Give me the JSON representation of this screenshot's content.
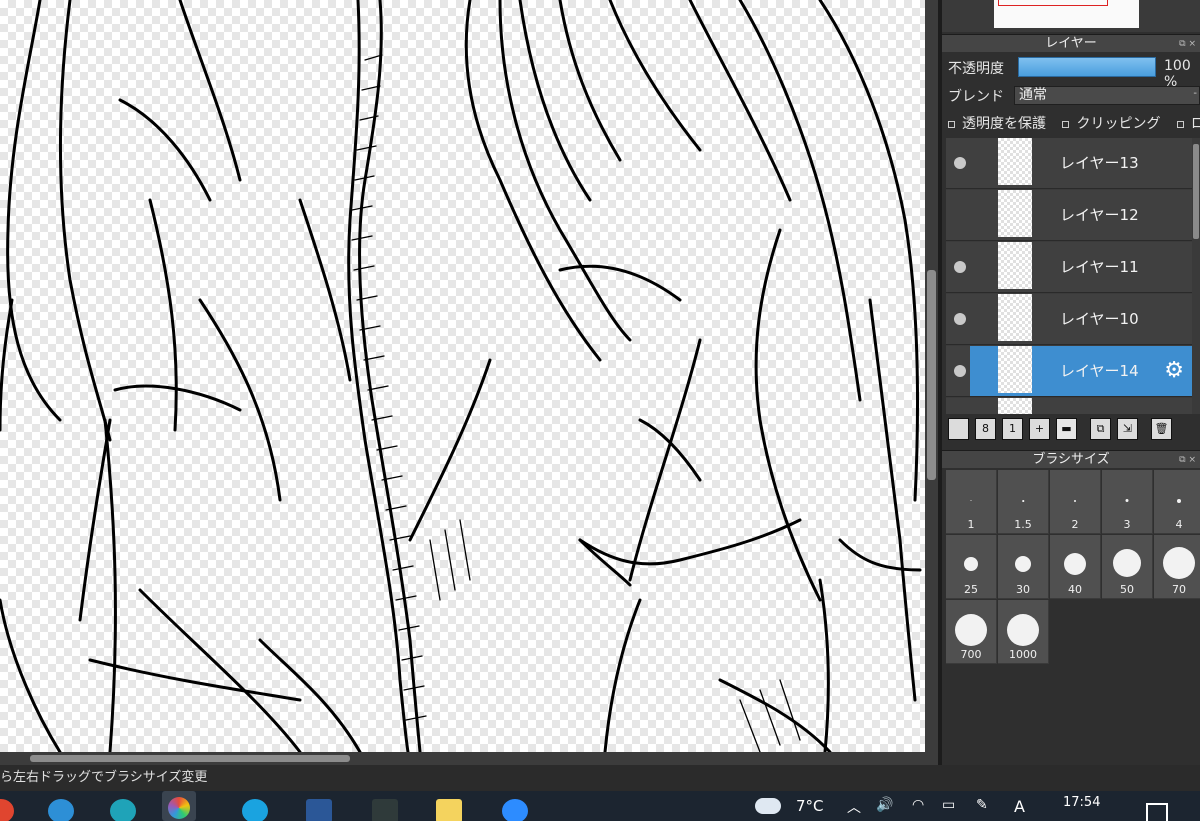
{
  "layer_panel": {
    "title": "レイヤー",
    "opacity_label": "不透明度",
    "opacity_value": "100 %",
    "opacity_percent": 100,
    "blend_label": "ブレンド",
    "blend_value": "通常",
    "options": [
      {
        "label": "透明度を保護"
      },
      {
        "label": "クリッピング"
      },
      {
        "label": "ロック"
      }
    ],
    "layers": [
      {
        "name": "レイヤー13",
        "visible": true,
        "selected": false
      },
      {
        "name": "レイヤー12",
        "visible": false,
        "selected": false
      },
      {
        "name": "レイヤー11",
        "visible": true,
        "selected": false
      },
      {
        "name": "レイヤー10",
        "visible": true,
        "selected": false
      },
      {
        "name": "レイヤー14",
        "visible": true,
        "selected": true
      }
    ],
    "toolbar": [
      {
        "name": "new-layer-button",
        "icon": "page-icon",
        "glyph": ""
      },
      {
        "name": "new-8bit-layer-button",
        "icon": "page-8-icon",
        "glyph": "8"
      },
      {
        "name": "new-1bit-layer-button",
        "icon": "page-1-icon",
        "glyph": "1"
      },
      {
        "name": "add-layer-menu-button",
        "icon": "page-plus-icon",
        "glyph": "+"
      },
      {
        "name": "new-folder-button",
        "icon": "folder-icon",
        "glyph": ""
      },
      {
        "name": "duplicate-layer-button",
        "icon": "duplicate-icon",
        "glyph": ""
      },
      {
        "name": "merge-layer-button",
        "icon": "merge-icon",
        "glyph": ""
      },
      {
        "name": "delete-layer-button",
        "icon": "trash-icon",
        "glyph": ""
      }
    ]
  },
  "brush_panel": {
    "title": "ブラシサイズ",
    "sizes": [
      "1",
      "1.5",
      "2",
      "3",
      "4",
      "25",
      "30",
      "40",
      "50",
      "70",
      "700",
      "1000"
    ]
  },
  "status": {
    "text": "ら左右ドラッグでブラシサイズ変更"
  },
  "taskbar": {
    "temperature": "7°C",
    "time": "17:54",
    "ime": "A",
    "apps": [
      {
        "name": "chrome-icon",
        "color": "#e0452f"
      },
      {
        "name": "internet-explorer-icon",
        "color": "#2d8fd6"
      },
      {
        "name": "edge-icon",
        "color": "#1fa3b8"
      },
      {
        "name": "medibang-icon",
        "color": "#f2f2f2"
      },
      {
        "name": "skype-icon",
        "color": "#1aa3e0"
      },
      {
        "name": "word-icon",
        "color": "#2b5797"
      },
      {
        "name": "video-icon",
        "color": "#2f3a3a"
      },
      {
        "name": "live-icon",
        "color": "#f4d35e"
      },
      {
        "name": "zoom-icon",
        "color": "#2d8cff"
      }
    ]
  },
  "colors": {
    "selected_layer": "#3e8ed0",
    "opacity_bar": "#5aaae6"
  }
}
